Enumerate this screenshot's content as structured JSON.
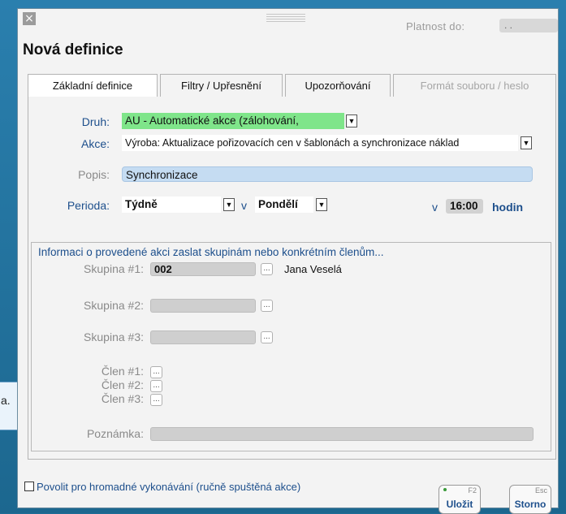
{
  "dialog": {
    "close_glyph": "×",
    "platnost_label": "Platnost do:",
    "platnost_value": ". .",
    "title": "Nová definice"
  },
  "tabs": [
    {
      "label": "Základní definice",
      "active": true
    },
    {
      "label": "Filtry / Upřesnění",
      "active": false
    },
    {
      "label": "Upozorňování",
      "active": false
    },
    {
      "label": "Formát souboru / heslo",
      "active": false,
      "disabled": true
    }
  ],
  "form": {
    "druh_label": "Druh:",
    "druh_value": "AU - Automatické akce (zálohování,",
    "akce_label": "Akce:",
    "akce_value": "Výroba: Aktualizace pořizovacích cen v šablonách a synchronizace náklad",
    "popis_label": "Popis:",
    "popis_value": "Synchronizace",
    "perioda_label": "Perioda:",
    "perioda_value": "Týdně",
    "v_label": "v",
    "den_value": "Pondělí",
    "cas_v_label": "v",
    "cas_value": "16:00",
    "hodin_label": "hodin"
  },
  "section": {
    "title": "Informaci o provedené akci zaslat skupinám nebo konkrétním členům...",
    "skupina1_label": "Skupina #1:",
    "skupina1_value": "002",
    "skupina1_member": "Jana Veselá",
    "skupina2_label": "Skupina #2:",
    "skupina3_label": "Skupina #3:",
    "clen1_label": "Člen #1:",
    "clen2_label": "Člen #2:",
    "clen3_label": "Člen #3:",
    "poznamka_label": "Poznámka:",
    "dots": "..."
  },
  "footer": {
    "checkbox_label": "Povolit pro hromadné vykonávání (ručně spuštěná akce)",
    "ulozit_label": "Uložit",
    "ulozit_key": "F2",
    "storno_label": "Storno",
    "storno_key": "Esc"
  },
  "tooltip": {
    "text": "a."
  },
  "colors": {
    "accent": "#1d4f8c",
    "druh_bg": "#7fe58a",
    "popis_bg": "#c5dcf2",
    "background": "#1f6d96"
  }
}
